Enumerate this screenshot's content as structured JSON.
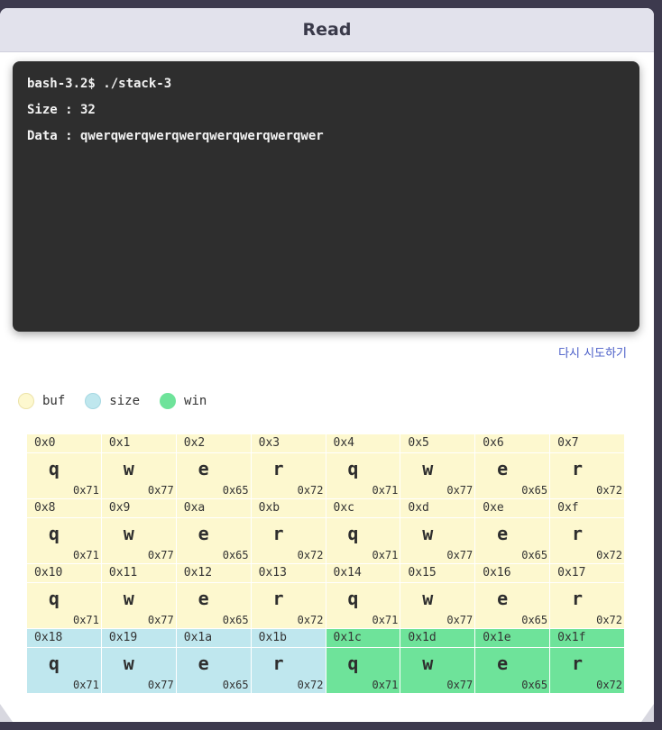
{
  "window": {
    "title": "Read"
  },
  "terminal": {
    "lines": [
      "bash-3.2$ ./stack-3",
      "Size : 32",
      "Data : qwerqwerqwerqwerqwerqwerqwerqwer"
    ]
  },
  "retry_label": "다시 시도하기",
  "legend": [
    {
      "label": "buf",
      "color": "#fdf8cf"
    },
    {
      "label": "size",
      "color": "#bfe7ee"
    },
    {
      "label": "win",
      "color": "#6ee39a"
    }
  ],
  "memory": [
    {
      "addr": "0x0",
      "char": "q",
      "hex": "0x71",
      "region": "buf"
    },
    {
      "addr": "0x1",
      "char": "w",
      "hex": "0x77",
      "region": "buf"
    },
    {
      "addr": "0x2",
      "char": "e",
      "hex": "0x65",
      "region": "buf"
    },
    {
      "addr": "0x3",
      "char": "r",
      "hex": "0x72",
      "region": "buf"
    },
    {
      "addr": "0x4",
      "char": "q",
      "hex": "0x71",
      "region": "buf"
    },
    {
      "addr": "0x5",
      "char": "w",
      "hex": "0x77",
      "region": "buf"
    },
    {
      "addr": "0x6",
      "char": "e",
      "hex": "0x65",
      "region": "buf"
    },
    {
      "addr": "0x7",
      "char": "r",
      "hex": "0x72",
      "region": "buf"
    },
    {
      "addr": "0x8",
      "char": "q",
      "hex": "0x71",
      "region": "buf"
    },
    {
      "addr": "0x9",
      "char": "w",
      "hex": "0x77",
      "region": "buf"
    },
    {
      "addr": "0xa",
      "char": "e",
      "hex": "0x65",
      "region": "buf"
    },
    {
      "addr": "0xb",
      "char": "r",
      "hex": "0x72",
      "region": "buf"
    },
    {
      "addr": "0xc",
      "char": "q",
      "hex": "0x71",
      "region": "buf"
    },
    {
      "addr": "0xd",
      "char": "w",
      "hex": "0x77",
      "region": "buf"
    },
    {
      "addr": "0xe",
      "char": "e",
      "hex": "0x65",
      "region": "buf"
    },
    {
      "addr": "0xf",
      "char": "r",
      "hex": "0x72",
      "region": "buf"
    },
    {
      "addr": "0x10",
      "char": "q",
      "hex": "0x71",
      "region": "buf"
    },
    {
      "addr": "0x11",
      "char": "w",
      "hex": "0x77",
      "region": "buf"
    },
    {
      "addr": "0x12",
      "char": "e",
      "hex": "0x65",
      "region": "buf"
    },
    {
      "addr": "0x13",
      "char": "r",
      "hex": "0x72",
      "region": "buf"
    },
    {
      "addr": "0x14",
      "char": "q",
      "hex": "0x71",
      "region": "buf"
    },
    {
      "addr": "0x15",
      "char": "w",
      "hex": "0x77",
      "region": "buf"
    },
    {
      "addr": "0x16",
      "char": "e",
      "hex": "0x65",
      "region": "buf"
    },
    {
      "addr": "0x17",
      "char": "r",
      "hex": "0x72",
      "region": "buf"
    },
    {
      "addr": "0x18",
      "char": "q",
      "hex": "0x71",
      "region": "size"
    },
    {
      "addr": "0x19",
      "char": "w",
      "hex": "0x77",
      "region": "size"
    },
    {
      "addr": "0x1a",
      "char": "e",
      "hex": "0x65",
      "region": "size"
    },
    {
      "addr": "0x1b",
      "char": "r",
      "hex": "0x72",
      "region": "size"
    },
    {
      "addr": "0x1c",
      "char": "q",
      "hex": "0x71",
      "region": "win"
    },
    {
      "addr": "0x1d",
      "char": "w",
      "hex": "0x77",
      "region": "win"
    },
    {
      "addr": "0x1e",
      "char": "e",
      "hex": "0x65",
      "region": "win"
    },
    {
      "addr": "0x1f",
      "char": "r",
      "hex": "0x72",
      "region": "win"
    }
  ]
}
